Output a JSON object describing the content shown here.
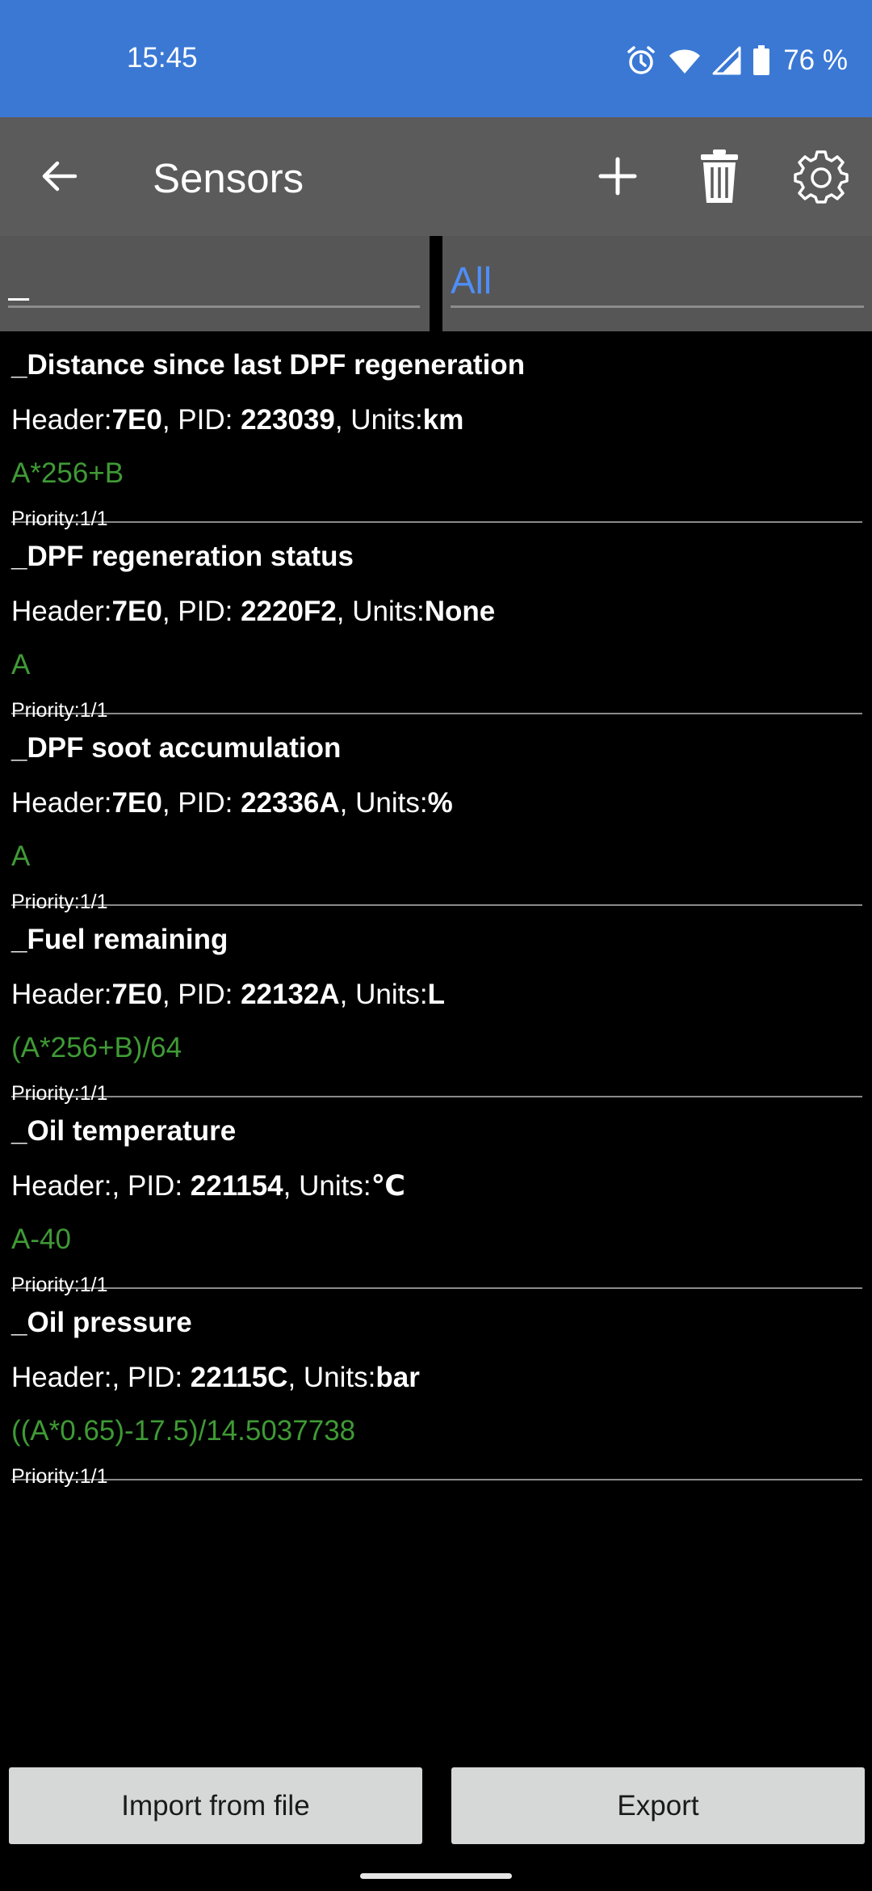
{
  "status_bar": {
    "time": "15:45",
    "battery": "76 %",
    "icons": [
      "alarm-icon",
      "wifi-icon",
      "signal-icon",
      "battery-icon"
    ]
  },
  "toolbar": {
    "title": "Sensors",
    "icons": [
      "back-arrow-icon",
      "plus-icon",
      "trash-icon",
      "gear-icon"
    ]
  },
  "filter": {
    "search_value": "_",
    "category_value": "All"
  },
  "labels": {
    "header": "Header:",
    "pid": ", PID: ",
    "units": ", Units:",
    "priority": "Priority:"
  },
  "sensors": [
    {
      "name": "_Distance since last DPF regeneration",
      "header": "7E0",
      "pid": "223039",
      "units": "km",
      "formula": "A*256+B",
      "priority": "1/1"
    },
    {
      "name": "_DPF regeneration status",
      "header": "7E0",
      "pid": "2220F2",
      "units": "None",
      "formula": "A",
      "priority": "1/1"
    },
    {
      "name": "_DPF soot accumulation",
      "header": "7E0",
      "pid": "22336A",
      "units": "%",
      "formula": "A",
      "priority": "1/1"
    },
    {
      "name": "_Fuel remaining",
      "header": "7E0",
      "pid": "22132A",
      "units": "L",
      "formula": "(A*256+B)/64",
      "priority": "1/1"
    },
    {
      "name": "_Oil temperature",
      "header": "",
      "pid": "221154",
      "units": "℃",
      "formula": "A-40",
      "priority": "1/1"
    },
    {
      "name": "_Oil pressure",
      "header": "",
      "pid": "22115C",
      "units": "bar",
      "formula": "((A*0.65)-17.5)/14.5037738",
      "priority": "1/1"
    }
  ],
  "buttons": {
    "import_label": "Import from file",
    "export_label": "Export"
  },
  "colors": {
    "status_bar": "#3a78d4",
    "toolbar": "#5b5b5b",
    "formula_green": "#3f9a35",
    "accent_blue": "#4f8ef7"
  }
}
